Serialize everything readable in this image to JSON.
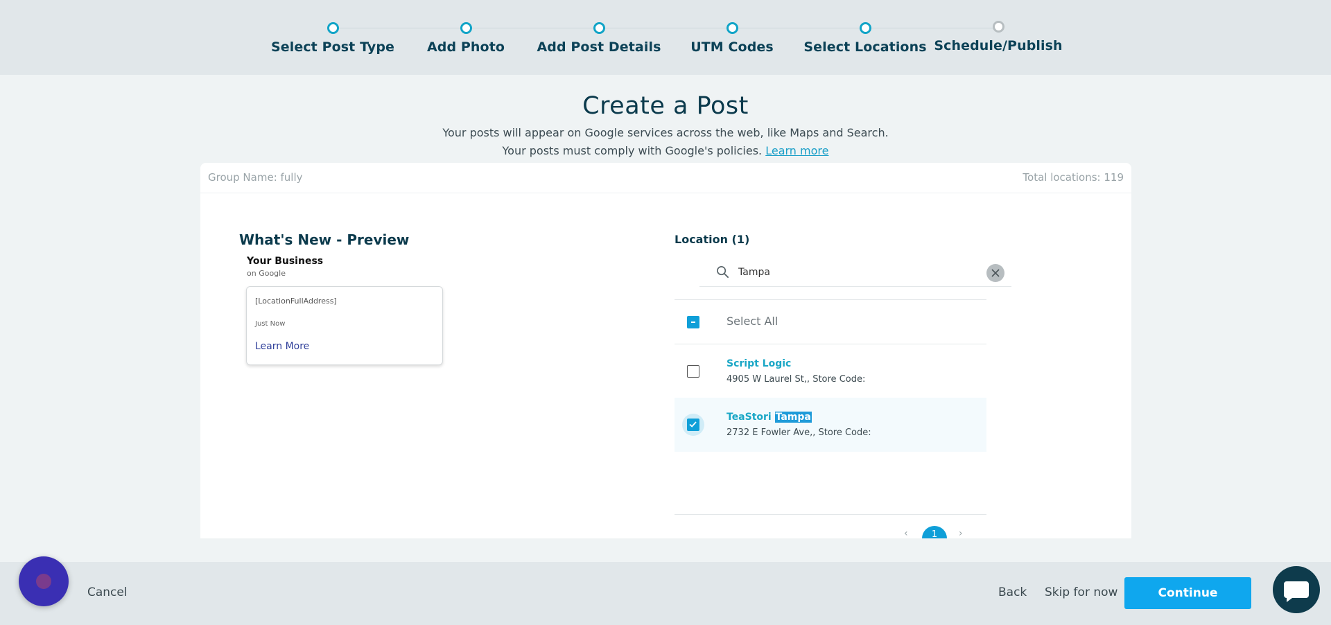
{
  "stepper": {
    "steps": [
      {
        "label": "Select Post Type",
        "state": "done"
      },
      {
        "label": "Add Photo",
        "state": "done"
      },
      {
        "label": "Add Post Details",
        "state": "done"
      },
      {
        "label": "UTM Codes",
        "state": "done"
      },
      {
        "label": "Select Locations",
        "state": "current"
      },
      {
        "label": "Schedule/Publish",
        "state": "future"
      }
    ]
  },
  "header": {
    "title": "Create a Post",
    "subtitle_1": "Your posts will appear on Google services across the web, like Maps and Search.",
    "subtitle_2": "Your posts must comply with Google's policies.",
    "learn_more": "Learn more"
  },
  "card": {
    "group_name": "Group Name: fully",
    "total_locations": "Total locations: 119"
  },
  "preview": {
    "title": "What's New - Preview",
    "business_name": "Your Business",
    "on_google": "on Google",
    "address": "[LocationFullAddress]",
    "time": "Just Now",
    "cta": "Learn More"
  },
  "locations": {
    "title": "Location (1)",
    "search_value": "Tampa",
    "select_all_label": "Select All",
    "items": [
      {
        "name": "Script Logic",
        "name_highlight": "",
        "address": "4905 W Laurel St,, Store Code:",
        "checked": false
      },
      {
        "name": "TeaStori ",
        "name_highlight": "Tampa",
        "address": "2732 E Fowler Ave,, Store Code:",
        "checked": true
      }
    ],
    "pager": {
      "prev": "‹",
      "page": "1",
      "next": "›"
    }
  },
  "footer": {
    "cancel": "Cancel",
    "back": "Back",
    "skip": "Skip for now",
    "continue": "Continue"
  },
  "colors": {
    "accent": "#0fa7ee",
    "step_done": "#11a4c7",
    "step_future": "#b7bec1",
    "dark_text": "#0b3a4c"
  }
}
